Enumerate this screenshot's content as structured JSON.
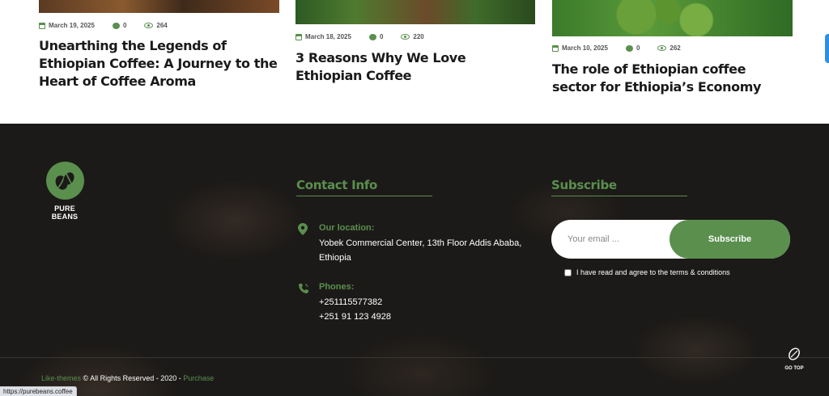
{
  "posts": [
    {
      "date": "March 19, 2025",
      "comments": "0",
      "views": "264",
      "title": "Unearthing the Legends of Ethiopian Coffee: A Journey to the Heart of Coffee Aroma"
    },
    {
      "date": "March 18, 2025",
      "comments": "0",
      "views": "220",
      "title": "3 Reasons Why We Love Ethiopian Coffee"
    },
    {
      "date": "March 10, 2025",
      "comments": "0",
      "views": "262",
      "title": "The role of Ethiopian coffee sector for Ethiopia’s Economy"
    }
  ],
  "footer": {
    "logo_name": "PURE BEANS",
    "contact": {
      "title": "Contact Info",
      "location_label": "Our location:",
      "address_line1": "Yobek Commercial Center, 13th Floor Addis Ababa,",
      "address_line2": "Ethiopia",
      "phones_label": "Phones:",
      "phone1": "+251115577382",
      "phone2": "+251 91 123 4928"
    },
    "subscribe": {
      "title": "Subscribe",
      "email_placeholder": "Your email ...",
      "button_label": "Subscribe",
      "agree_text": "I have read and agree to the terms & conditions"
    },
    "copyright": {
      "brand_link": "Like-themes",
      "text": " © All Rights Reserved - 2020 - ",
      "purchase_link": "Purchase"
    },
    "go_top_label": "GO TOP"
  },
  "status_url": "https://purebeans.coffee",
  "colors": {
    "accent": "#5a8f4e",
    "footer_bg": "#1c1a18",
    "title_text": "#1a1a1a"
  }
}
